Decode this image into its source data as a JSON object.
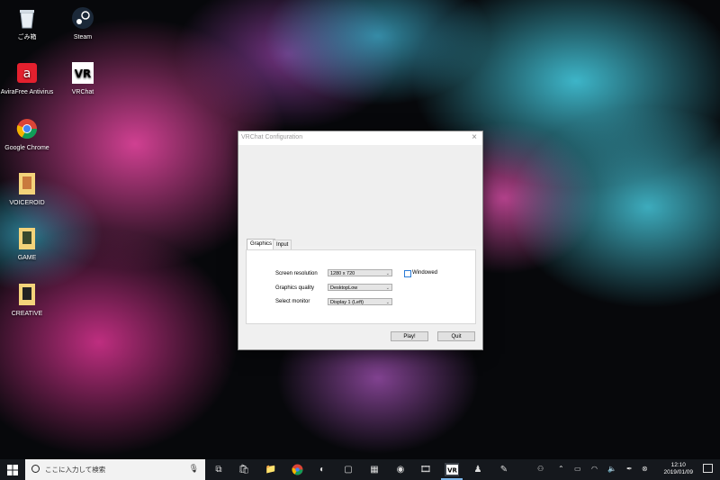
{
  "desktop": {
    "icons": [
      {
        "label": "ごみ箱"
      },
      {
        "label": "Steam"
      },
      {
        "label": "AviraFree Antivirus"
      },
      {
        "label": "VRChat"
      },
      {
        "label": "Google Chrome"
      },
      {
        "label": "VOICEROID"
      },
      {
        "label": "GAME"
      },
      {
        "label": "CREATIVE"
      }
    ]
  },
  "dialog": {
    "title": "VRChat Configuration",
    "close_glyph": "×",
    "tabs": [
      {
        "label": "Graphics",
        "active": true
      },
      {
        "label": "Input",
        "active": false
      }
    ],
    "graphics": {
      "screen_resolution_label": "Screen resolution",
      "screen_resolution_value": "1280 x 720",
      "windowed_label": "Windowed",
      "windowed_checked": false,
      "graphics_quality_label": "Graphics quality",
      "graphics_quality_value": "DesktopLow",
      "select_monitor_label": "Select monitor",
      "select_monitor_value": "Display 1 (Left)"
    },
    "buttons": {
      "play_label": "Play!",
      "quit_label": "Quit"
    }
  },
  "taskbar": {
    "search_placeholder": "ここに入力して検索",
    "apps": [
      {
        "icon": "task-view-icon"
      },
      {
        "icon": "store-icon"
      },
      {
        "icon": "file-explorer-icon"
      },
      {
        "icon": "chrome-icon"
      },
      {
        "icon": "app-icon"
      },
      {
        "icon": "app-icon"
      },
      {
        "icon": "app-icon"
      },
      {
        "icon": "app-icon"
      },
      {
        "icon": "film-icon"
      },
      {
        "icon": "vrchat-icon"
      },
      {
        "icon": "app-icon"
      },
      {
        "icon": "app-icon"
      }
    ],
    "clock_time": "12:10",
    "clock_date": "2019/01/09",
    "accent_color": "#7ab4e8"
  }
}
